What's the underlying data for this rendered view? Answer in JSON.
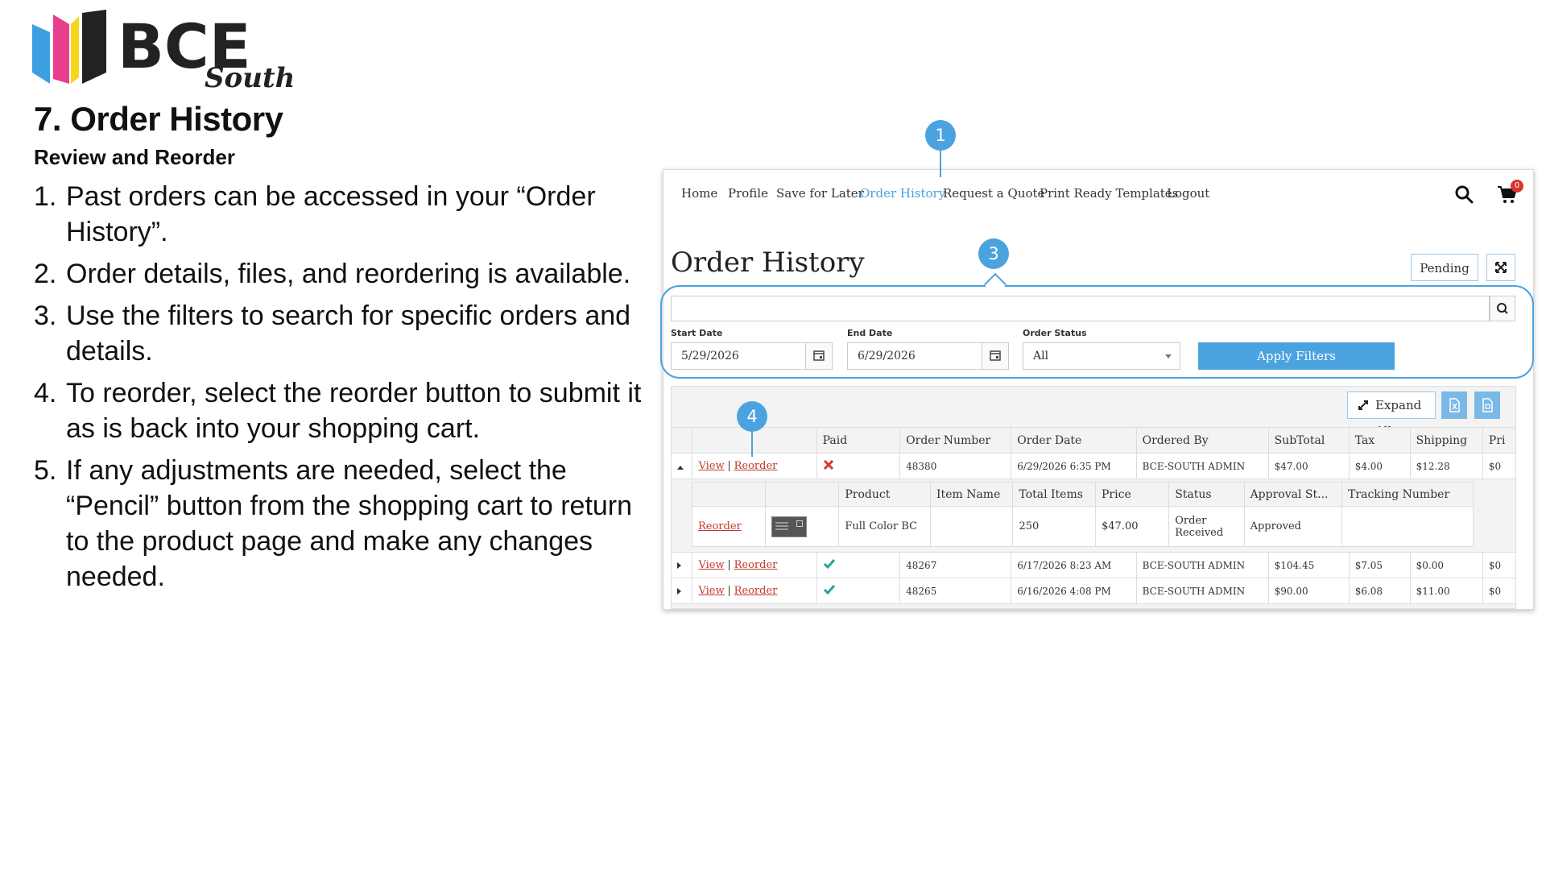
{
  "slide": {
    "title": "7. Order History",
    "subtitle": "Review and Reorder",
    "steps": [
      {
        "num": "1.",
        "text": "Past orders can be accessed in your “Order History”."
      },
      {
        "num": "2.",
        "text": "Order details, files, and reordering is available."
      },
      {
        "num": "3.",
        "text": "Use the filters to search for specific orders and details."
      },
      {
        "num": "4.",
        "text": "To reorder, select the reorder button to submit it as is back into your shopping cart."
      },
      {
        "num": "5.",
        "text": "If any adjustments are needed, select the “Pencil” button from the shopping cart to return to the product page and make any changes needed."
      }
    ]
  },
  "logo": {
    "text": "BCE",
    "script": "South",
    "colors": [
      "#3d9fe0",
      "#e83e8c",
      "#f7d51d",
      "#222222"
    ]
  },
  "callouts": {
    "c1": "1",
    "c3": "3",
    "c4": "4"
  },
  "nav": {
    "items": [
      "Home",
      "Profile",
      "Save for Later",
      "Order History",
      "Request a Quote",
      "Print Ready Templates",
      "Logout"
    ],
    "active": "Order History",
    "cart_count": "0"
  },
  "page": {
    "title": "Order History",
    "pending_label": "Pending"
  },
  "filters": {
    "search_value": "",
    "start_date_label": "Start Date",
    "start_date": "5/29/2026",
    "end_date_label": "End Date",
    "end_date": "6/29/2026",
    "status_label": "Order Status",
    "status_value": "All",
    "apply_label": "Apply Filters"
  },
  "toolbar": {
    "expand_all_label": "Expand All"
  },
  "orders_table": {
    "columns": [
      "",
      "",
      "Paid",
      "Order Number",
      "Order Date",
      "Ordered By",
      "SubTotal",
      "Tax",
      "Shipping",
      "Pri"
    ],
    "view_label": "View",
    "reorder_label": "Reorder",
    "separator": "|",
    "rows": [
      {
        "expanded": true,
        "paid": false,
        "order_number": "48380",
        "order_date": "6/29/2026 6:35 PM",
        "ordered_by": "BCE-SOUTH ADMIN",
        "subtotal": "$47.00",
        "tax": "$4.00",
        "shipping": "$12.28",
        "price": "$0"
      },
      {
        "expanded": false,
        "paid": true,
        "order_number": "48267",
        "order_date": "6/17/2026 8:23 AM",
        "ordered_by": "BCE-SOUTH ADMIN",
        "subtotal": "$104.45",
        "tax": "$7.05",
        "shipping": "$0.00",
        "price": "$0"
      },
      {
        "expanded": false,
        "paid": true,
        "order_number": "48265",
        "order_date": "6/16/2026 4:08 PM",
        "ordered_by": "BCE-SOUTH ADMIN",
        "subtotal": "$90.00",
        "tax": "$6.08",
        "shipping": "$11.00",
        "price": "$0"
      }
    ]
  },
  "detail_table": {
    "columns": [
      "",
      "",
      "Product",
      "Item Name",
      "Total Items",
      "Price",
      "Status",
      "Approval St...",
      "Tracking Number"
    ],
    "row": {
      "reorder_label": "Reorder",
      "product": "Full Color BC",
      "item_name": "",
      "total_items": "250",
      "price": "$47.00",
      "status_line1": "Order",
      "status_line2": "Received",
      "approval": "Approved",
      "tracking": ""
    }
  },
  "icons": {
    "paid_yes": "check-icon",
    "paid_no": "x-icon",
    "accent": "#4aa3df",
    "danger": "#d9342b",
    "success": "#2aa198"
  }
}
